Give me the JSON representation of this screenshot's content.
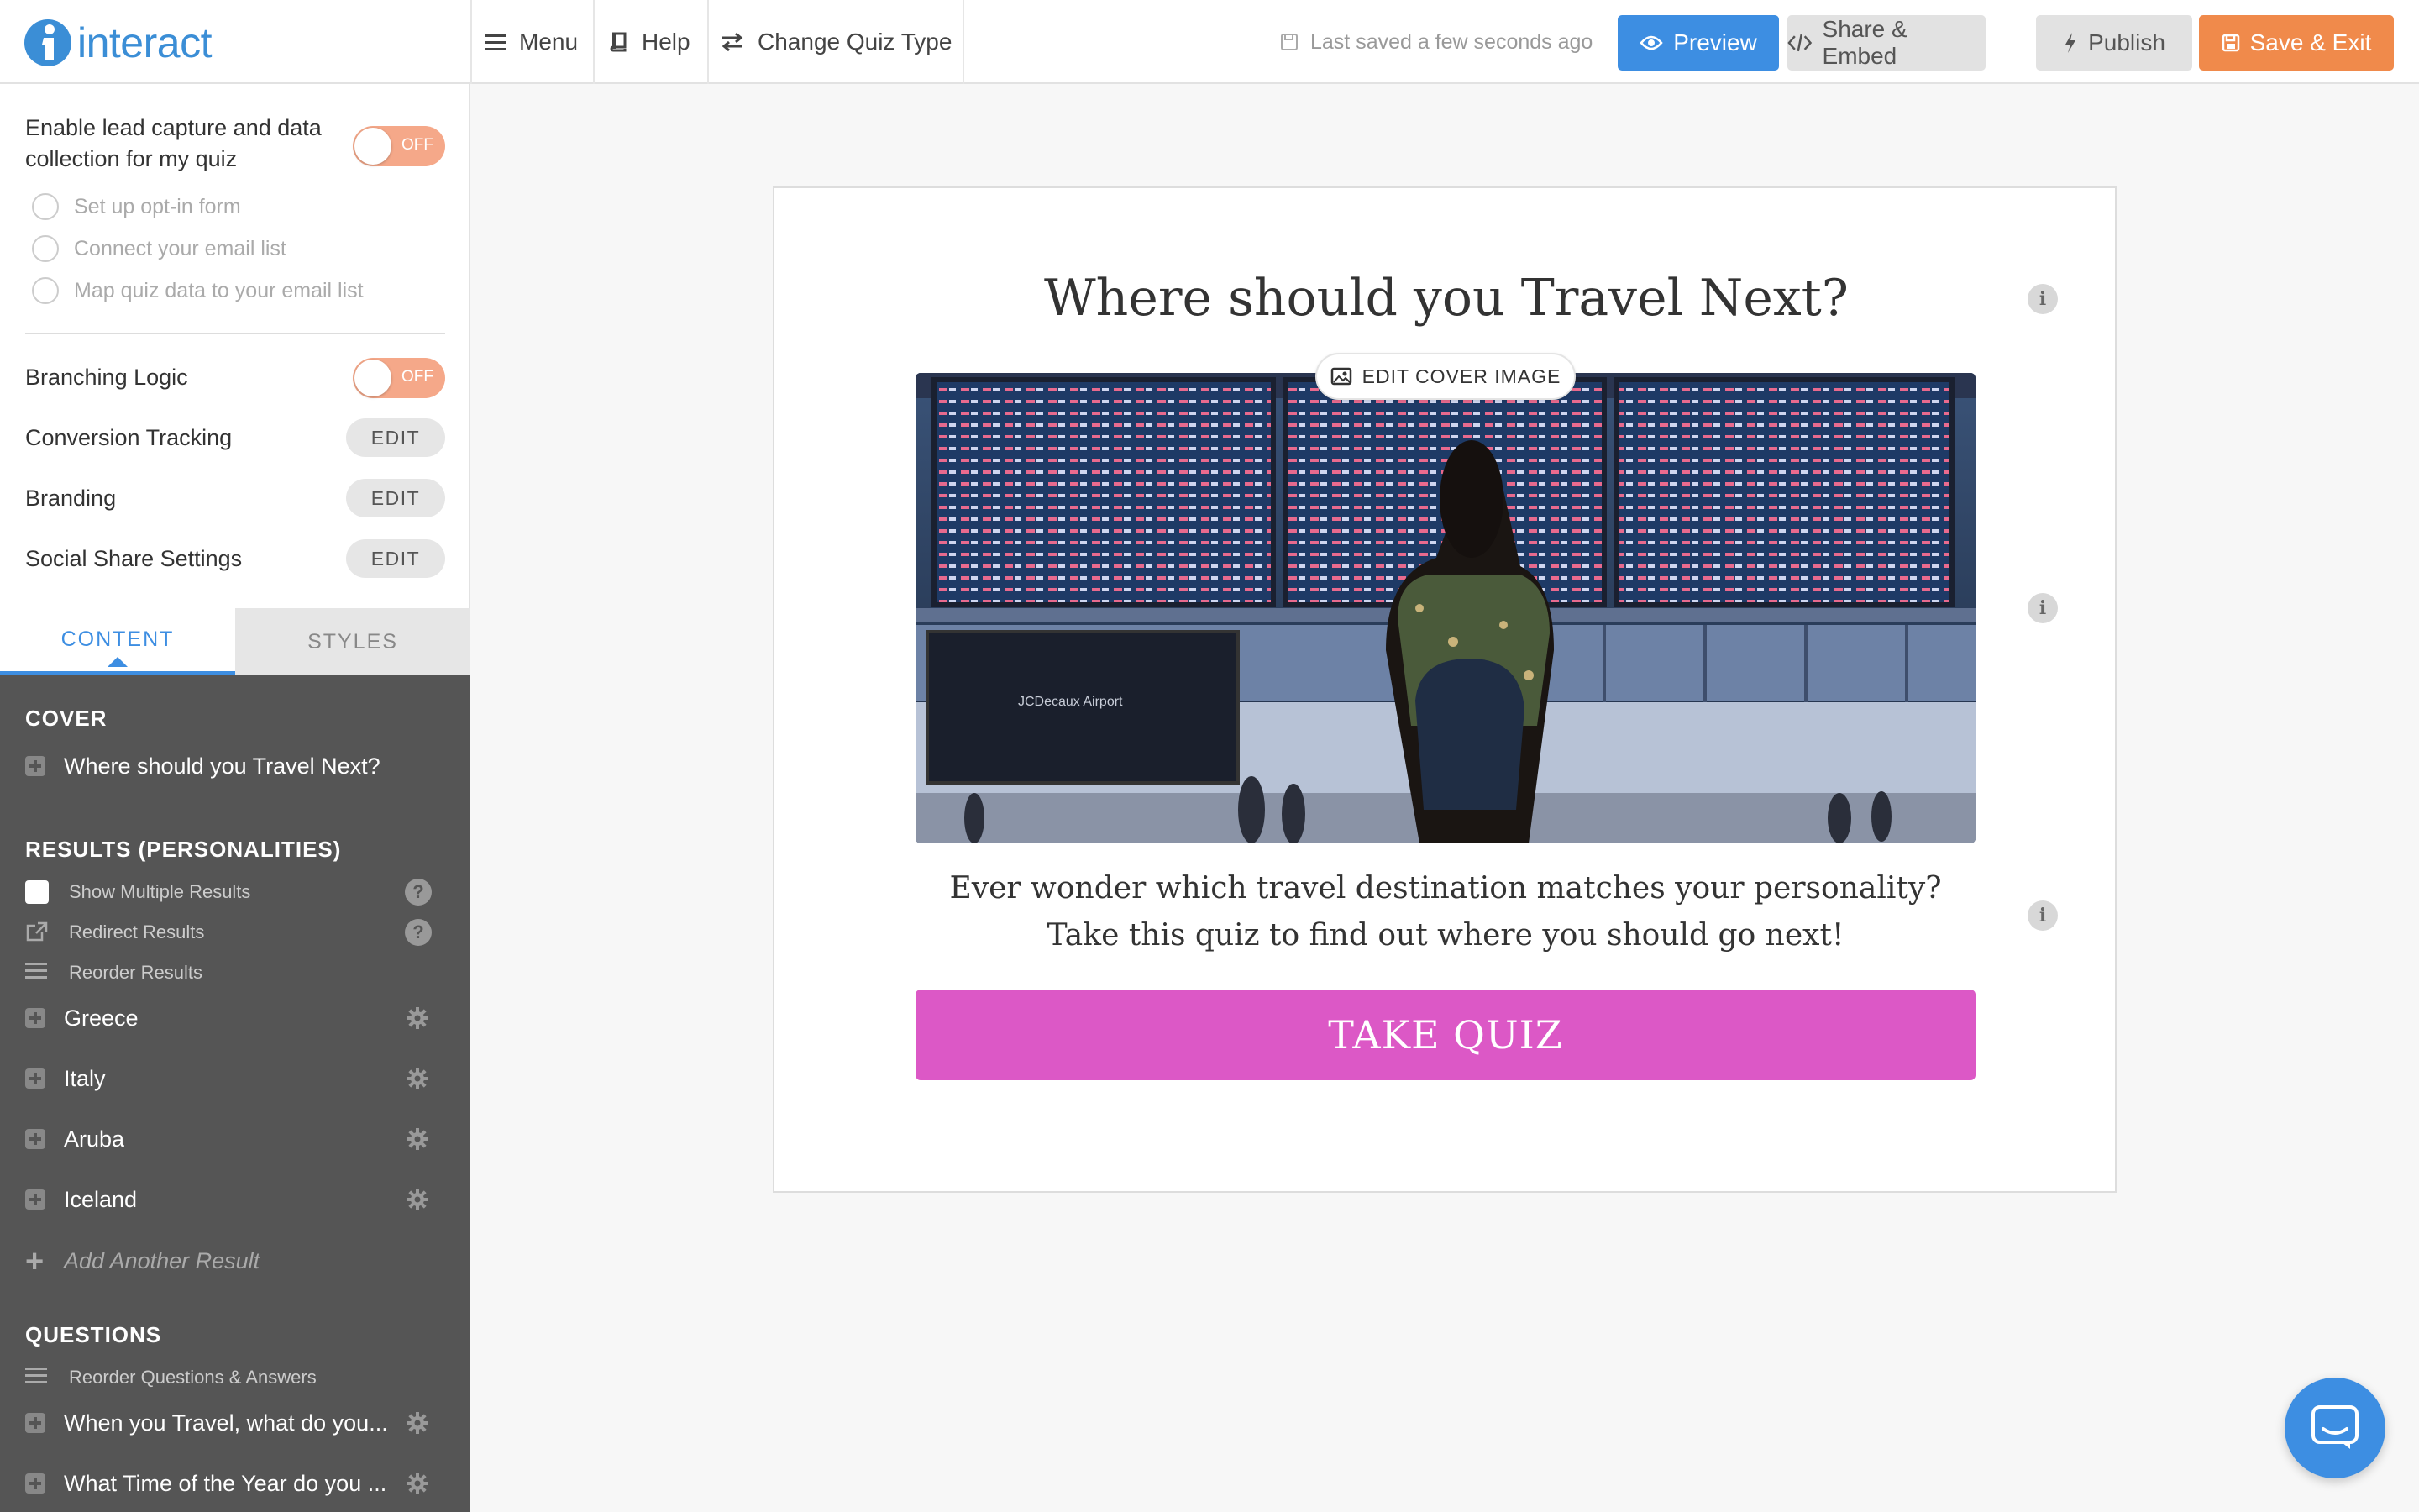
{
  "app": {
    "logo_text": "interact",
    "brand_color": "#3b8ed6"
  },
  "nav": {
    "menu_label": "Menu",
    "help_label": "Help",
    "change_type_label": "Change Quiz Type",
    "saved_status": "Last saved a few seconds ago"
  },
  "toolbar": {
    "preview_label": "Preview",
    "share_label": "Share & Embed",
    "publish_label": "Publish",
    "save_exit_label": "Save & Exit"
  },
  "settings": {
    "lead_capture_label": "Enable lead capture and data collection for my quiz",
    "lead_capture_toggle": "OFF",
    "lead_options": [
      "Set up opt-in form",
      "Connect your email list",
      "Map quiz data to your email list"
    ],
    "branching_label": "Branching Logic",
    "branching_toggle": "OFF",
    "conversion_label": "Conversion Tracking",
    "branding_label": "Branding",
    "social_label": "Social Share Settings",
    "edit_label": "EDIT"
  },
  "tabs": {
    "content": "CONTENT",
    "styles": "STYLES",
    "active": "content"
  },
  "content_panel": {
    "cover_title": "COVER",
    "cover_item": "Where should you Travel Next?",
    "results_title": "RESULTS (PERSONALITIES)",
    "show_multiple": "Show Multiple Results",
    "redirect": "Redirect Results",
    "reorder_results": "Reorder Results",
    "results": [
      "Greece",
      "Italy",
      "Aruba",
      "Iceland"
    ],
    "add_result": "Add Another Result",
    "questions_title": "QUESTIONS",
    "reorder_questions": "Reorder Questions & Answers",
    "questions": [
      "When you Travel, what do you...",
      "What Time of the Year do you ..."
    ]
  },
  "quiz": {
    "title": "Where should you Travel Next?",
    "edit_cover_label": "EDIT COVER IMAGE",
    "cover_image_text": "JCDecaux Airport",
    "description": "Ever wonder which travel destination matches your personality? Take this quiz to find out where you should go next!",
    "cta_label": "TAKE QUIZ",
    "cta_color": "#dc58c6"
  },
  "colors": {
    "preview": "#3d8ee2",
    "save_exit": "#f08a4b",
    "toggle_off": "#f5a889",
    "panel_bg": "#555555"
  }
}
